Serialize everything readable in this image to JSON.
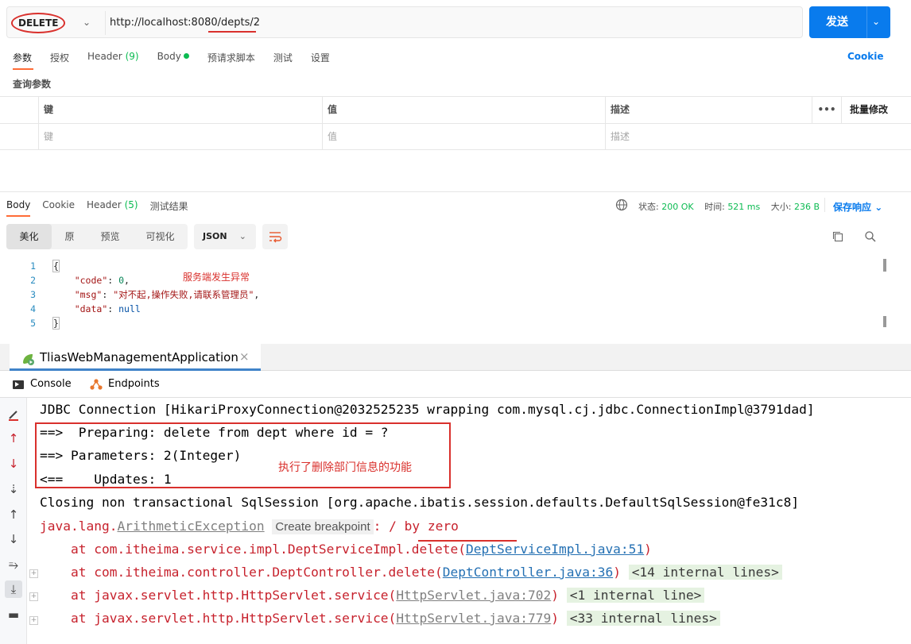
{
  "request": {
    "method": "DELETE",
    "url": "http://localhost:8080/depts/2",
    "send_label": "发送"
  },
  "request_tabs": [
    {
      "label": "参数",
      "active": true
    },
    {
      "label": "授权"
    },
    {
      "label": "Header",
      "count": "(9)"
    },
    {
      "label": "Body",
      "dot": true
    },
    {
      "label": "预请求脚本"
    },
    {
      "label": "测试"
    },
    {
      "label": "设置"
    }
  ],
  "cookie_link": "Cookie",
  "query_title": "查询参数",
  "params_table": {
    "headers": {
      "key": "键",
      "value": "值",
      "desc": "描述",
      "more": "•••",
      "bulk": "批量修改"
    },
    "placeholders": {
      "key": "键",
      "value": "值",
      "desc": "描述"
    }
  },
  "response_tabs": [
    {
      "label": "Body",
      "active": true
    },
    {
      "label": "Cookie"
    },
    {
      "label": "Header",
      "count": "(5)"
    },
    {
      "label": "测试结果"
    }
  ],
  "response_status": {
    "status_label": "状态:",
    "status_value": "200 OK",
    "time_label": "时间:",
    "time_value": "521 ms",
    "size_label": "大小:",
    "size_value": "236 B",
    "save_label": "保存响应"
  },
  "view_modes": [
    "美化",
    "原",
    "预览",
    "可视化"
  ],
  "format": "JSON",
  "code_lines": [
    {
      "n": "1",
      "t": "{"
    },
    {
      "n": "2",
      "key": "\"code\"",
      "val": "0",
      "vt": "num",
      "comma": ","
    },
    {
      "n": "3",
      "key": "\"msg\"",
      "val": "\"对不起,操作失败,请联系管理员\"",
      "vt": "str",
      "comma": ","
    },
    {
      "n": "4",
      "key": "\"data\"",
      "val": "null",
      "vt": "kw",
      "comma": ""
    },
    {
      "n": "5",
      "t": "}"
    }
  ],
  "annotation_response": "服务端发生异常",
  "ide": {
    "run_tab": "TliasWebManagementApplication",
    "sub_tabs": [
      "Console",
      "Endpoints"
    ],
    "log": {
      "l1": "JDBC Connection [HikariProxyConnection@2032525235 wrapping com.mysql.cj.jdbc.ConnectionImpl@3791dad]",
      "l2": "==>  Preparing: delete from dept where id = ?",
      "l3": "==> Parameters: 2(Integer)",
      "l4": "<==    Updates: 1",
      "l5": "Closing non transactional SqlSession [org.apache.ibatis.session.defaults.DefaultSqlSession@fe31c8]",
      "l6_prefix": "java.lang.",
      "l6_exception": "ArithmeticException",
      "l6_breakpoint": "Create breakpoint",
      "l6_suffix": ": / by zero",
      "at1_text": "    at com.itheima.service.impl.DeptServiceImpl.delete(",
      "at1_link": "DeptServiceImpl.java:51",
      "at2_text": "    at com.itheima.controller.DeptController.delete(",
      "at2_link": "DeptController.java:36",
      "at2_internal": "<14 internal lines>",
      "at3_text": "    at javax.servlet.http.HttpServlet.service(",
      "at3_link": "HttpServlet.java:702",
      "at3_internal": "<1 internal line>",
      "at4_text": "    at javax.servlet.http.HttpServlet.service(",
      "at4_link": "HttpServlet.java:779",
      "at4_internal": "<33 internal lines>",
      "close_paren": ")"
    },
    "annotation": "执行了删除部门信息的功能"
  },
  "colors": {
    "accent_blue": "#097bed",
    "active_tab_orange": "#ff6c37",
    "status_green": "#0cbb52",
    "annotation_red": "#d9302c"
  }
}
